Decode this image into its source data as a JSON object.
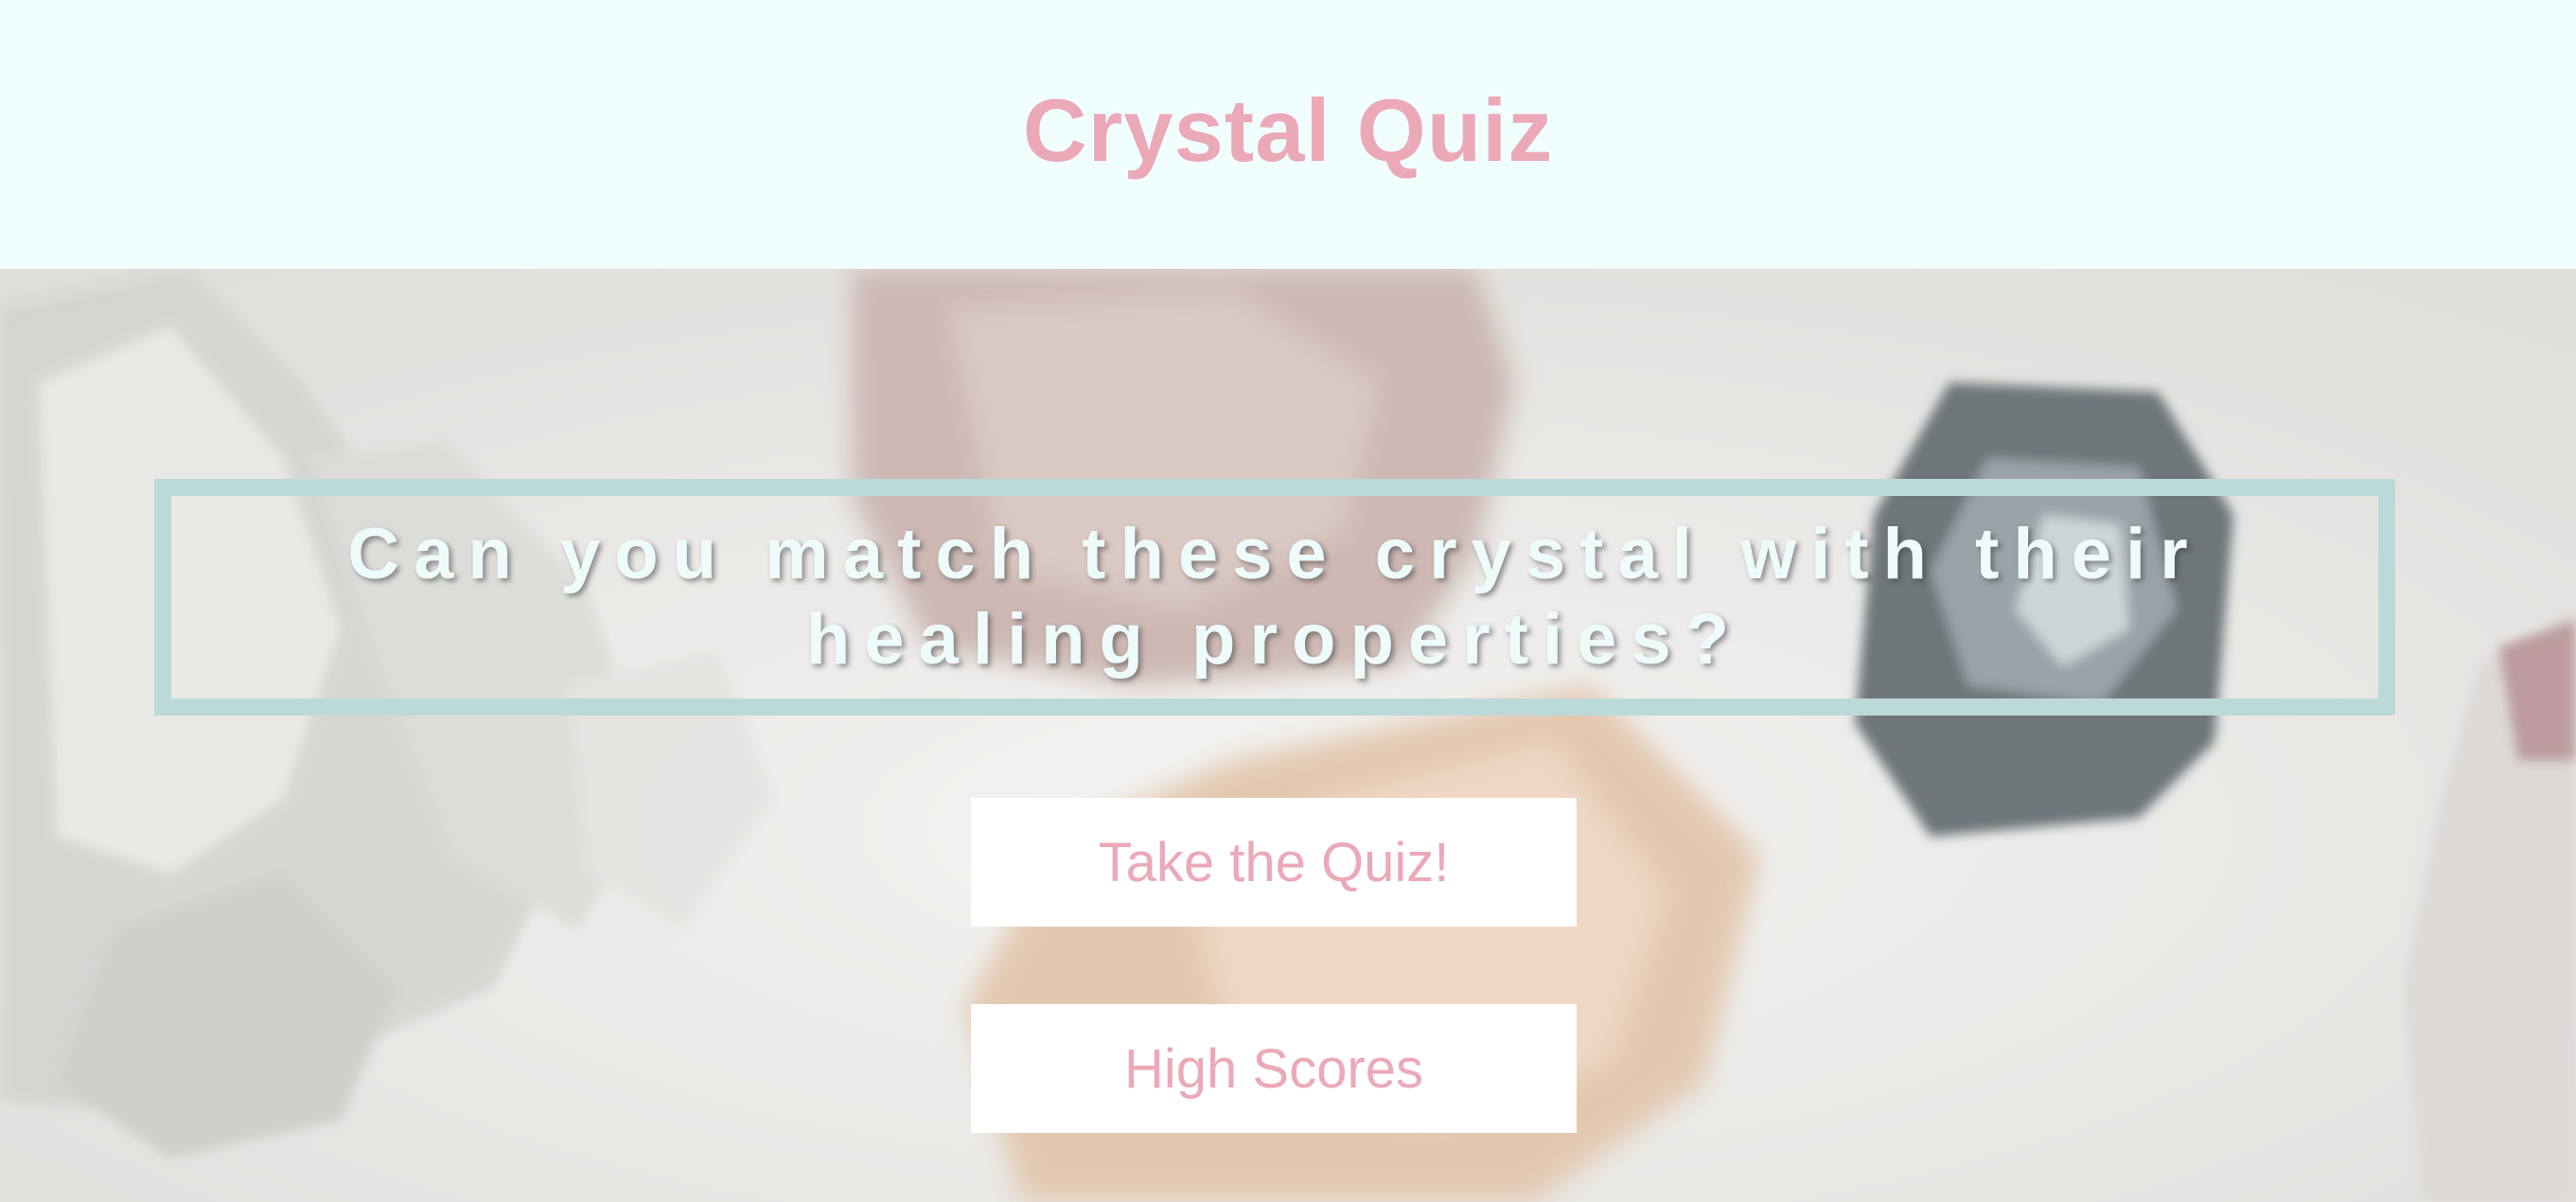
{
  "header": {
    "title": "Crystal Quiz"
  },
  "hero": {
    "tagline": "Can you match these crystal with their healing properties?",
    "buttons": {
      "take_quiz": "Take the Quiz!",
      "high_scores": "High Scores"
    }
  },
  "colors": {
    "header_bg": "#f0fffe",
    "accent_pink": "#eba9b8",
    "frame": "#bcd9da",
    "tagline_text": "#eefbfb",
    "button_bg": "#ffffff"
  }
}
